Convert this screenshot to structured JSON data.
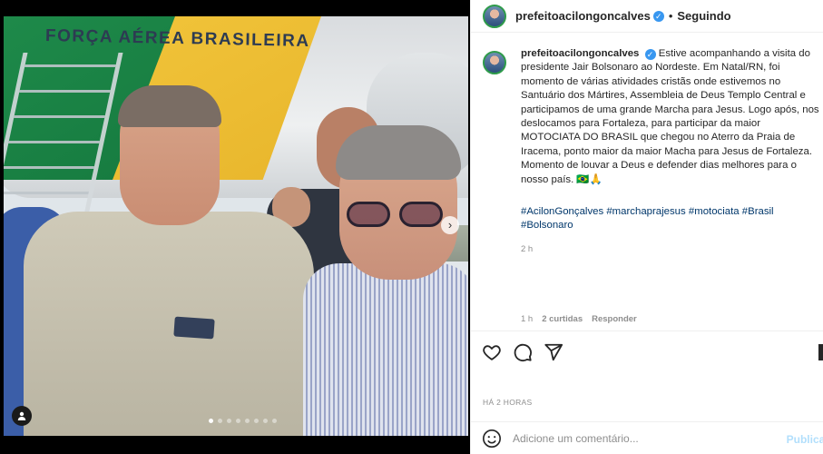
{
  "post": {
    "username": "prefeitoacilongoncalves",
    "follow_status": "Seguindo",
    "caption": "Estive acompanhando a visita do presidente Jair Bolsonaro ao Nordeste. Em Natal/RN, foi momento de várias atividades cristãs onde estivemos no Santuário dos Mártires, Assembleia de Deus Templo Central e participamos de uma grande Marcha para Jesus. Logo após, nos deslocamos para Fortaleza, para participar da maior MOTOCIATA DO BRASIL que chegou no Aterro da Praia de Iracema, ponto maior da maior Macha para Jesus de Fortaleza. Momento de louvar a Deus e defender dias melhores para o nosso país. 🇧🇷🙏",
    "hashtags": "#AcilonGonçalves #marchaprajesus #motociata #Brasil #Bolsonaro",
    "caption_time": "2 h",
    "meta": {
      "time": "1 h",
      "likes": "2 curtidas",
      "reply": "Responder"
    },
    "posted_time": "HÁ 2 HORAS",
    "comment_placeholder": "Adicione um comentário...",
    "publish_label": "Publicar"
  },
  "photo": {
    "plane_text": "FORÇA AÉREA BRASILEIRA",
    "carousel_count": 8,
    "carousel_active": 0
  },
  "colors": {
    "link": "#00376b",
    "muted": "#8e8e8e",
    "verified": "#3897f0",
    "publish_disabled": "#b2dffc"
  },
  "icons": [
    "verified-badge-icon",
    "heart-icon",
    "comment-icon",
    "share-icon",
    "bookmark-icon",
    "emoji-icon",
    "tag-user-icon",
    "next-arrow-icon"
  ]
}
